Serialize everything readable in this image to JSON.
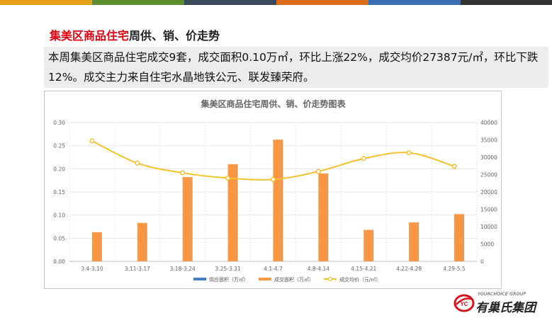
{
  "heading": {
    "highlight": "集美区商品住宅",
    "rest": "周供、销、价走势"
  },
  "summary": "本周集美区商品住宅成交9套，成交面积0.10万㎡，环比上涨22%，成交均价27387元/㎡，环比下跌12%。成交主力来自住宅水晶地铁公元、联发臻荣府。",
  "brand": {
    "top": "YOURCHOICE GROUP",
    "name": "有巢氏集团",
    "badge": "YC"
  },
  "colors": {
    "accent_red": "#e0000f",
    "supply": "#4a7fbf",
    "sales": "#f79646",
    "price": "#f2c12e",
    "topbar": [
      "#e4a017",
      "#5c8c2e",
      "#3a4a5a",
      "#d96b1a",
      "#3a6fb6",
      "#333333"
    ]
  },
  "chart_data": {
    "type": "bar",
    "title": "集美区商品住宅周供、销、价走势图表",
    "categories": [
      "3.4-3.10",
      "3.11-3.17",
      "3.18-3.24",
      "3.25-3.31",
      "4.1-4.7",
      "4.8-4.14",
      "4.15-4.21",
      "4.22-4.28",
      "4.29-5.5"
    ],
    "y_left": {
      "ylim": [
        0,
        0.3
      ],
      "ticks": [
        "0.00",
        "0.05",
        "0.10",
        "0.15",
        "0.20",
        "0.25",
        "0.30"
      ]
    },
    "y_right": {
      "ylim": [
        0,
        40000
      ],
      "ticks": [
        "0",
        "5000",
        "10000",
        "15000",
        "20000",
        "25000",
        "30000",
        "35000",
        "40000"
      ]
    },
    "series": [
      {
        "name": "供应面积（万㎡）",
        "kind": "bar",
        "axis": "left",
        "values": [
          0,
          0,
          0,
          0,
          0,
          0,
          0,
          0,
          0
        ]
      },
      {
        "name": "成交面积（万㎡）",
        "kind": "bar",
        "axis": "left",
        "values": [
          0.063,
          0.083,
          0.182,
          0.21,
          0.263,
          0.19,
          0.068,
          0.084,
          0.102
        ]
      },
      {
        "name": "成交均价（元/㎡）",
        "kind": "line",
        "axis": "right",
        "values": [
          34700,
          28300,
          25500,
          24000,
          23600,
          25900,
          29600,
          31300,
          27387
        ]
      }
    ],
    "grid": true,
    "legend": "bottom"
  }
}
